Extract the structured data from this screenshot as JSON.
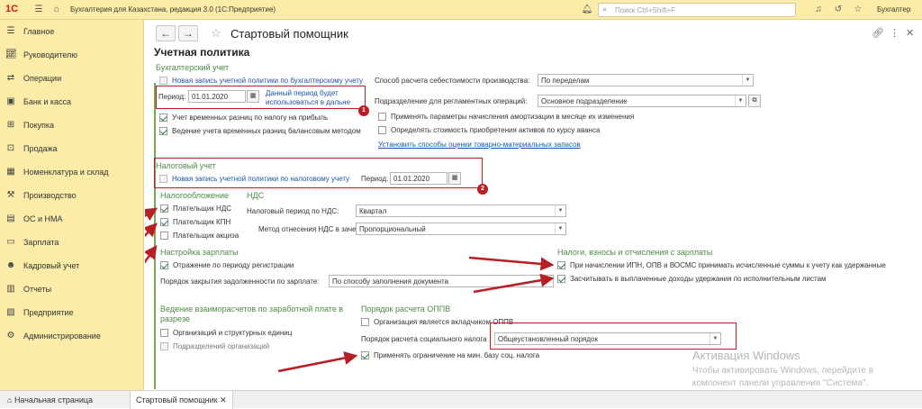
{
  "app": {
    "logo": "1С",
    "title": "Бухгалтерия для Казахстана, редакция 3.0  (1С:Предприятие)",
    "search_placeholder": "Поиск Ctrl+Shift+F",
    "user": "Бухгалтер"
  },
  "sidebar": {
    "items": [
      {
        "label": "Главное",
        "icon": "menu-icon"
      },
      {
        "label": "Руководителю",
        "icon": "chart-icon"
      },
      {
        "label": "Операции",
        "icon": "operations-icon"
      },
      {
        "label": "Банк и касса",
        "icon": "bank-icon"
      },
      {
        "label": "Покупка",
        "icon": "cart-icon"
      },
      {
        "label": "Продажа",
        "icon": "sale-icon"
      },
      {
        "label": "Номенклатура и склад",
        "icon": "warehouse-icon"
      },
      {
        "label": "Производство",
        "icon": "production-icon"
      },
      {
        "label": "ОС и НМА",
        "icon": "assets-icon"
      },
      {
        "label": "Зарплата",
        "icon": "salary-icon"
      },
      {
        "label": "Кадровый учет",
        "icon": "personnel-icon"
      },
      {
        "label": "Отчеты",
        "icon": "reports-icon"
      },
      {
        "label": "Предприятие",
        "icon": "enterprise-icon"
      },
      {
        "label": "Администрирование",
        "icon": "gear-icon"
      }
    ]
  },
  "page": {
    "title": "Стартовый помощник",
    "section_title": "Учетная политика"
  },
  "accounting": {
    "header": "Бухгалтерский учет",
    "new_record_label": "Новая запись учетной политики по бухгалтерскому учету",
    "period_label": "Период:",
    "period_value": "01.01.2020",
    "period_note_line1": "Данный период будет",
    "period_note_line2": "использоваться в дальне",
    "temp_diff_label": "Учет временных разниц по налогу на прибыль",
    "balance_method_label": "Ведение учета временных разниц балансовым методом",
    "cost_method_label": "Способ расчета себестоимости производства:",
    "cost_method_value": "По переделам",
    "division_label": "Подразделение для регламентных операций:",
    "division_value": "Основное подразделение",
    "amort_label": "Применять параметры начисления амортизации в месяце их изменения",
    "advance_label": "Определять стоимость приобретения активов по курсу аванса",
    "inventory_link": "Установить способы оценки товарно-материальных запасов",
    "badge": "1"
  },
  "tax": {
    "header": "Налоговый учет",
    "new_record_label": "Новая запись учетной политики по налоговому учету",
    "period_label": "Период:",
    "period_value": "01.01.2020",
    "badge": "2",
    "taxation_header": "Налогообложение",
    "vat_payer": "Плательщик НДС",
    "cit_payer": "Плательщик КПН",
    "excise_payer": "Плательщик акциза",
    "vat_header": "НДС",
    "vat_period_label": "Налоговый период по НДС:",
    "vat_period_value": "Квартал",
    "vat_method_label": "Метод отнесения НДС в зачет:",
    "vat_method_value": "Пропорциональный"
  },
  "salary": {
    "header": "Настройка зарплаты",
    "reflect_label": "Отражение по периоду регистрации",
    "closing_label": "Порядок закрытия задолженности по зарплате:",
    "closing_value": "По способу заполнения документа",
    "taxes_header": "Налоги, взносы и отчисления с зарплаты",
    "ipn_label": "При начислении ИПН, ОПВ и ВОСМС принимать исчисленные суммы к учету как удержанные",
    "offset_label": "Засчитывать в выплаченные доходы удержания по исполнительным листам",
    "settlements_header_line1": "Ведение взаиморасчетов по заработной плате в",
    "settlements_header_line2": "разрезе",
    "org_units_label": "Организаций и структурных единиц",
    "divisions_label": "Подразделений организаций",
    "opv_header": "Порядок расчета ОППВ",
    "opv_contrib_label": "Организация является вкладчиком ОППВ",
    "social_tax_label": "Порядок расчета социального налога",
    "social_tax_value": "Общеустановленный порядок",
    "min_base_label": "Применять ограничение на мин. базу соц. налога"
  },
  "watermark": {
    "line1": "Активация Windows",
    "line2": "Чтобы активировать Windows, перейдите в",
    "line3": "компонент панели управления \"Система\"."
  },
  "tabs": {
    "home": "Начальная страница",
    "current": "Стартовый помощник"
  },
  "colors": {
    "accent": "#b81e24",
    "panel": "#fbeca8",
    "section_green": "#4c8a43"
  }
}
